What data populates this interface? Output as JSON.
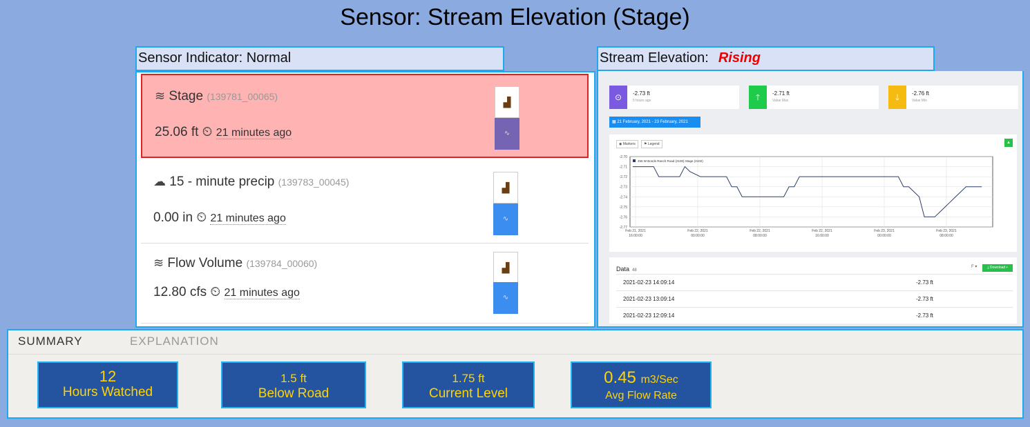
{
  "title": "Sensor: Stream Elevation (Stage)",
  "left": {
    "header_label": "Sensor Indicator: Normal",
    "sensors": [
      {
        "icon": "water-lines-icon",
        "name": "Stage",
        "id": "(139781_00065)",
        "value": "25.06 ft",
        "ago": "21 minutes ago"
      },
      {
        "icon": "rain-cloud-icon",
        "name": "15 - minute precip",
        "id": "(139783_00045)",
        "value": "0.00 in",
        "ago": "21 minutes ago"
      },
      {
        "icon": "water-lines-icon",
        "name": "Flow Volume",
        "id": "(139784_00060)",
        "value": "12.80 cfs",
        "ago": "21 minutes ago"
      }
    ]
  },
  "right": {
    "header_label": "Stream Elevation:",
    "header_status": "Rising",
    "stats": [
      {
        "value": "-2.73 ft",
        "sub": "5 hours ago",
        "color": "#7a5ae0",
        "icon": "clock-icon"
      },
      {
        "value": "-2.71 ft",
        "sub": "Value Max",
        "color": "#1ecb4a",
        "icon": "arrow-up-icon"
      },
      {
        "value": "-2.76 ft",
        "sub": "Value Min",
        "color": "#f6bb10",
        "icon": "arrow-down-icon"
      }
    ],
    "date_range": "21 February, 2021 - 23 February, 2021",
    "markers_label": "Markers",
    "legend_label": "Legend",
    "data_title": "Data",
    "data_count": "48",
    "download_label": "Download",
    "filter_label": "F",
    "rows": [
      {
        "date": "2021-02-23 14:09:14",
        "value": "-2.73 ft"
      },
      {
        "date": "2021-02-23 13:09:14",
        "value": "-2.73 ft"
      },
      {
        "date": "2021-02-23 12:09:14",
        "value": "-2.73 ft"
      }
    ]
  },
  "chart_data": {
    "type": "line",
    "legend": "455 W Bonds Ranch Road (2100) Stage (2102)",
    "ylim": [
      -2.77,
      -2.7
    ],
    "y_ticks": [
      "-2.70",
      "-2.71",
      "-2.72",
      "-2.73",
      "-2.74",
      "-2.75",
      "-2.76",
      "-2.77"
    ],
    "x_ticks": [
      [
        "Feb 21, 2021",
        "16:00:00"
      ],
      [
        "Feb 22, 2021",
        "00:00:00"
      ],
      [
        "Feb 22, 2021",
        "08:00:00"
      ],
      [
        "Feb 22, 2021",
        "16:00:00"
      ],
      [
        "Feb 23, 2021",
        "00:00:00"
      ],
      [
        "Feb 23, 2021",
        "08:00:00"
      ]
    ],
    "series": [
      {
        "x": [
          0,
          4,
          5,
          9,
          10,
          11,
          13,
          18,
          19,
          20,
          21,
          29,
          30,
          31,
          32,
          40,
          41,
          42,
          43,
          51,
          52,
          53,
          55,
          56,
          57,
          58,
          59,
          60,
          61,
          62,
          63,
          64,
          65,
          66,
          67
        ],
        "y": [
          -2.71,
          -2.71,
          -2.72,
          -2.72,
          -2.71,
          -2.715,
          -2.72,
          -2.72,
          -2.73,
          -2.73,
          -2.74,
          -2.74,
          -2.73,
          -2.73,
          -2.72,
          -2.72,
          -2.72,
          -2.72,
          -2.72,
          -2.72,
          -2.73,
          -2.73,
          -2.74,
          -2.76,
          -2.76,
          -2.76,
          -2.755,
          -2.75,
          -2.745,
          -2.74,
          -2.735,
          -2.73,
          -2.73,
          -2.73,
          -2.73
        ]
      }
    ]
  },
  "summary": {
    "tabs": [
      "SUMMARY",
      "EXPLANATION"
    ],
    "boxes": [
      {
        "big": "12",
        "label": "Hours Watched"
      },
      {
        "big": "1.5 ft",
        "label": "Below Road"
      },
      {
        "big": "1.75 ft",
        "label": "Current Level"
      },
      {
        "big": "0.45",
        "unit": "m3/Sec",
        "label": "Avg Flow Rate"
      }
    ]
  }
}
